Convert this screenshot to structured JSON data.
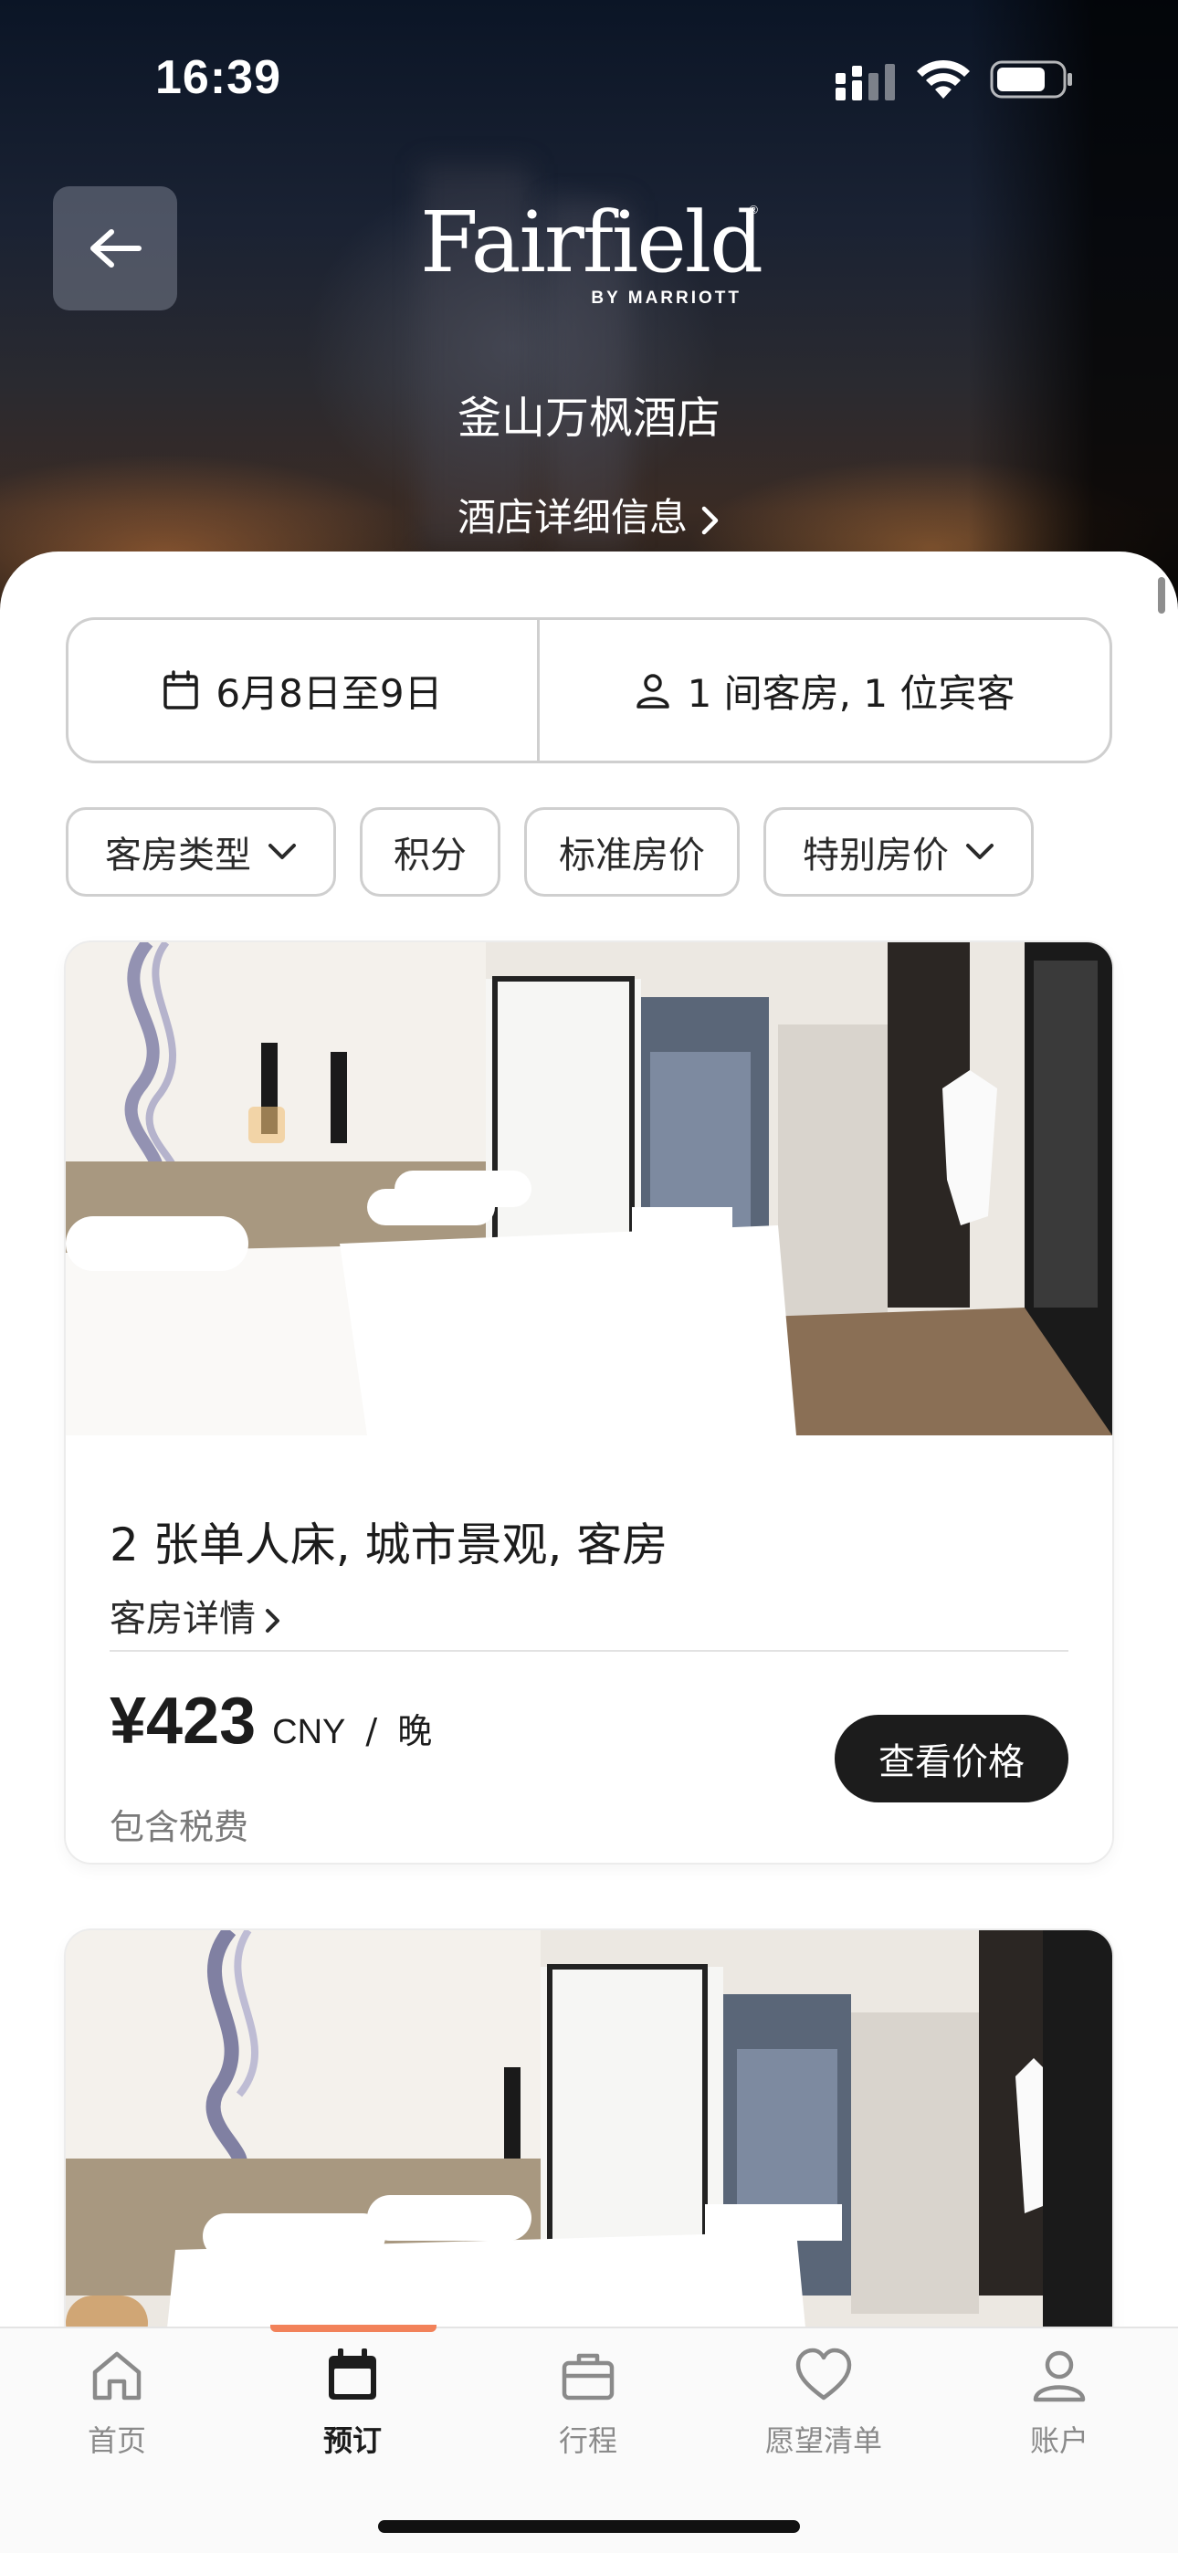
{
  "status_bar": {
    "time": "16:39"
  },
  "header": {
    "brand_name": "Fairfield",
    "brand_sub": "BY MARRIOTT",
    "brand_reg": "®",
    "hotel_name": "釜山万枫酒店",
    "hotel_details_link": "酒店详细信息"
  },
  "search": {
    "dates": "6月8日至9日",
    "guests": "1 间客房, 1 位宾客"
  },
  "filters": [
    {
      "label": "客房类型",
      "has_dropdown": true
    },
    {
      "label": "积分",
      "has_dropdown": false
    },
    {
      "label": "标准房价",
      "has_dropdown": false
    },
    {
      "label": "特别房价",
      "has_dropdown": true
    }
  ],
  "rooms": [
    {
      "title": "2 张单人床, 城市景观, 客房",
      "details_link": "客房详情",
      "price": "¥423",
      "currency": "CNY",
      "separator": "/",
      "unit": "晚",
      "tax_note": "包含税费",
      "cta": "查看价格"
    }
  ],
  "tabs": [
    {
      "label": "首页",
      "icon": "home-icon",
      "active": false
    },
    {
      "label": "预订",
      "icon": "calendar-icon",
      "active": true
    },
    {
      "label": "行程",
      "icon": "briefcase-icon",
      "active": false
    },
    {
      "label": "愿望清单",
      "icon": "heart-icon",
      "active": false
    },
    {
      "label": "账户",
      "icon": "person-icon",
      "active": false
    }
  ],
  "colors": {
    "accent_tab": "#f2825a",
    "primary_button": "#1c1c1c"
  }
}
